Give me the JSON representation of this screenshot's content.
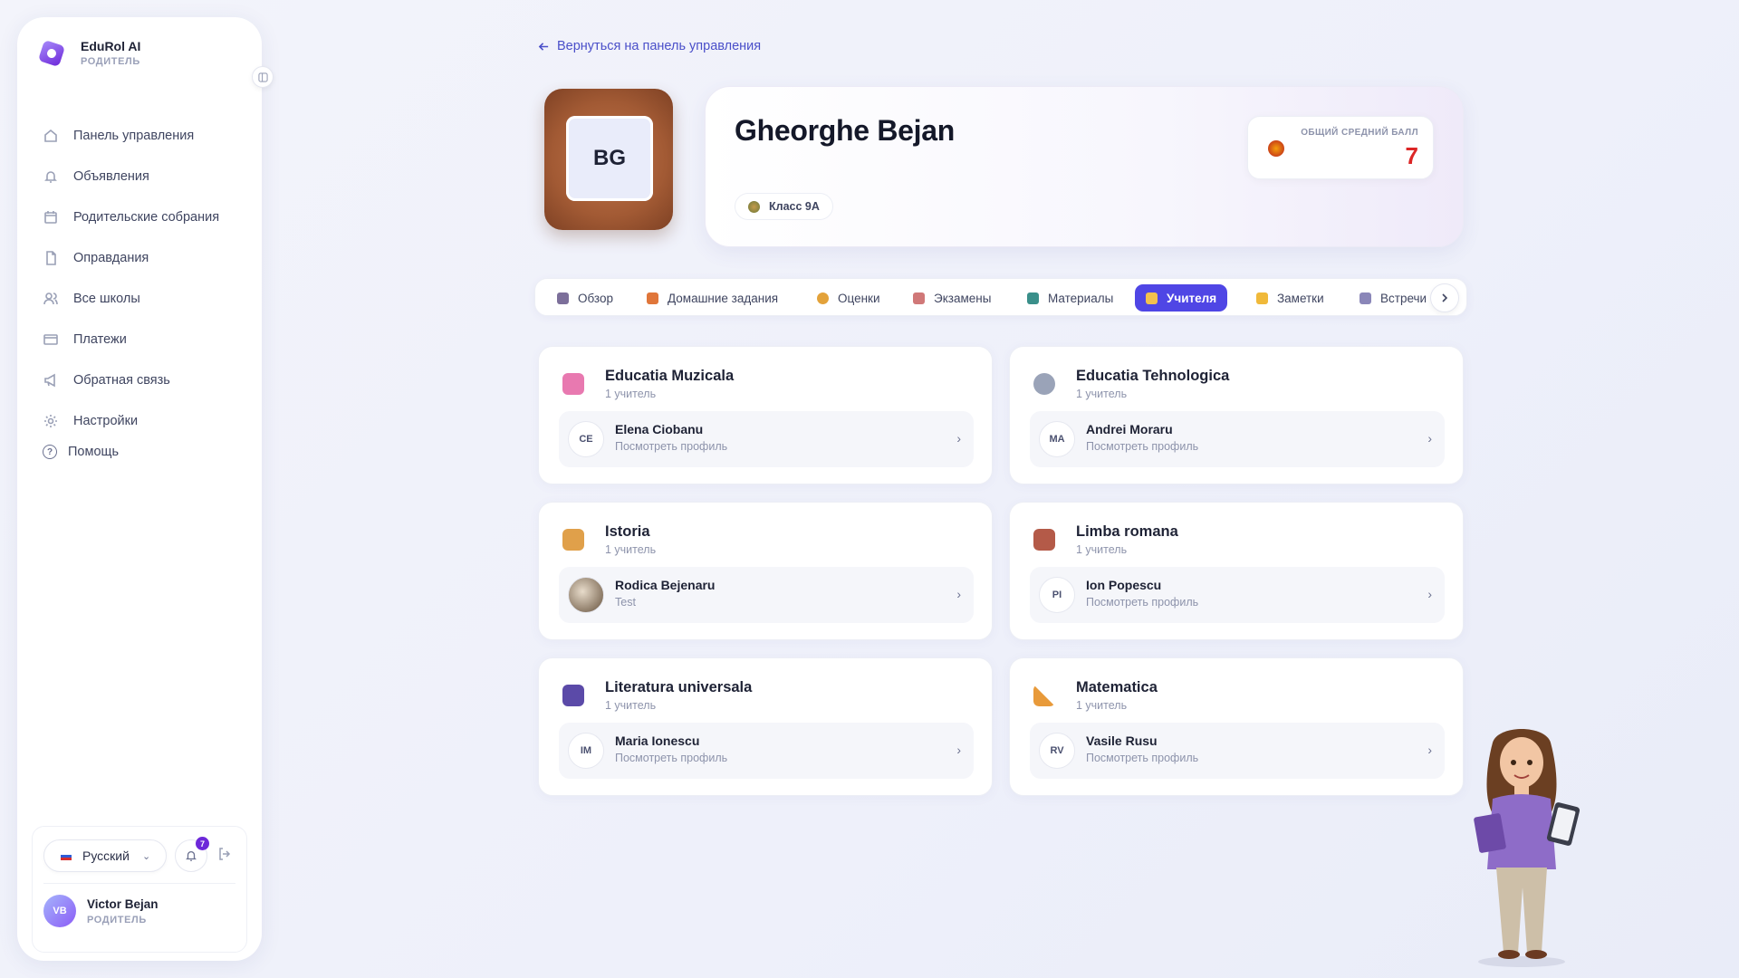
{
  "app": {
    "name": "EduRol AI",
    "role": "РОДИТЕЛЬ"
  },
  "sidebar": {
    "items": [
      {
        "label": "Панель управления",
        "icon": "home-icon"
      },
      {
        "label": "Объявления",
        "icon": "bell-icon"
      },
      {
        "label": "Родительские собрания",
        "icon": "calendar-icon"
      },
      {
        "label": "Оправдания",
        "icon": "document-icon"
      },
      {
        "label": "Все школы",
        "icon": "users-icon"
      },
      {
        "label": "Платежи",
        "icon": "card-icon"
      },
      {
        "label": "Обратная связь",
        "icon": "megaphone-icon"
      },
      {
        "label": "Настройки",
        "icon": "gear-icon"
      }
    ],
    "help": "Помощь",
    "language": "Русский",
    "notifications_count": "7",
    "user": {
      "initials": "VB",
      "name": "Victor Bejan",
      "role": "РОДИТЕЛЬ"
    }
  },
  "back_link": "Вернуться на панель управления",
  "student": {
    "initials": "BG",
    "name": "Gheorghe Bejan",
    "class": "Класс 9A",
    "gpa_label": "ОБЩИЙ СРЕДНИЙ БАЛЛ",
    "gpa_value": "7"
  },
  "tabs": [
    {
      "label": "Обзор",
      "color": "#7c6f9a"
    },
    {
      "label": "Домашние задания",
      "color": "#e0763a"
    },
    {
      "label": "Оценки",
      "color": "#e3a23a"
    },
    {
      "label": "Экзамены",
      "color": "#d07878"
    },
    {
      "label": "Материалы",
      "color": "#3a8f8a"
    },
    {
      "label": "Учителя",
      "color": "#f2c14e",
      "active": true
    },
    {
      "label": "Заметки",
      "color": "#f0b93a"
    },
    {
      "label": "Встречи",
      "color": "#8a86b8"
    }
  ],
  "subjects": [
    {
      "name": "Educatia Muzicala",
      "count": "1 учитель",
      "icon_color": "#e879b0",
      "teacher": {
        "initials": "CE",
        "name": "Elena Ciobanu",
        "sub": "Посмотреть профиль"
      }
    },
    {
      "name": "Educatia Tehnologica",
      "count": "1 учитель",
      "icon_color": "#9aa3b8",
      "teacher": {
        "initials": "MA",
        "name": "Andrei Moraru",
        "sub": "Посмотреть профиль"
      }
    },
    {
      "name": "Istoria",
      "count": "1 учитель",
      "icon_color": "#e0a04a",
      "teacher": {
        "initials": "",
        "name": "Rodica Bejenaru",
        "sub": "Test",
        "photo": true
      }
    },
    {
      "name": "Limba romana",
      "count": "1 учитель",
      "icon_color": "#b45a48",
      "teacher": {
        "initials": "PI",
        "name": "Ion Popescu",
        "sub": "Посмотреть профиль"
      }
    },
    {
      "name": "Literatura universala",
      "count": "1 учитель",
      "icon_color": "#5b4aa8",
      "teacher": {
        "initials": "IM",
        "name": "Maria Ionescu",
        "sub": "Посмотреть профиль"
      }
    },
    {
      "name": "Matematica",
      "count": "1 учитель",
      "icon_color": "#e89a3a",
      "teacher": {
        "initials": "RV",
        "name": "Vasile Rusu",
        "sub": "Посмотреть профиль"
      }
    }
  ]
}
